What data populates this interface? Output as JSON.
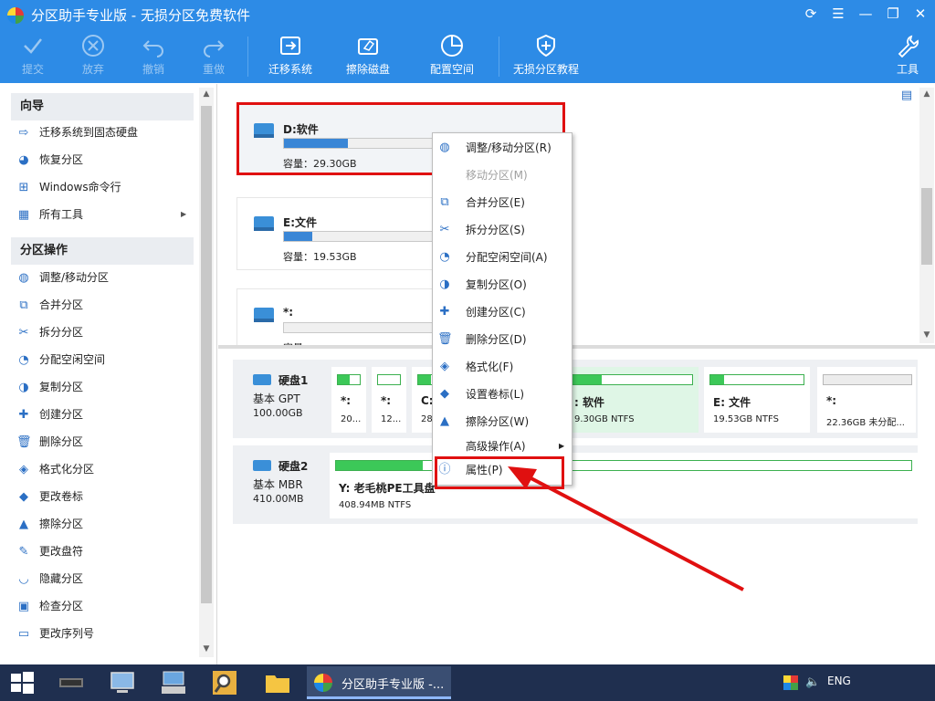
{
  "window": {
    "title": "分区助手专业版 - 无损分区免费软件"
  },
  "toolbar": {
    "submit": "提交",
    "discard": "放弃",
    "undo": "撤销",
    "redo": "重做",
    "migrate": "迁移系统",
    "wipe_disk": "擦除磁盘",
    "allocate": "配置空间",
    "tutorial": "无损分区教程",
    "tools": "工具"
  },
  "sidebar": {
    "wizard_header": "向导",
    "wizard_items": [
      {
        "label": "迁移系统到固态硬盘",
        "icon": "migrate-ssd-icon"
      },
      {
        "label": "恢复分区",
        "icon": "recover-icon"
      },
      {
        "label": "Windows命令行",
        "icon": "windows-icon"
      },
      {
        "label": "所有工具",
        "icon": "tools-grid-icon"
      }
    ],
    "ops_header": "分区操作",
    "ops_items": [
      {
        "label": "调整/移动分区",
        "icon": "resize-icon"
      },
      {
        "label": "合并分区",
        "icon": "merge-icon"
      },
      {
        "label": "拆分分区",
        "icon": "split-icon"
      },
      {
        "label": "分配空闲空间",
        "icon": "allocate-icon"
      },
      {
        "label": "复制分区",
        "icon": "copy-icon"
      },
      {
        "label": "创建分区",
        "icon": "create-icon"
      },
      {
        "label": "删除分区",
        "icon": "delete-icon"
      },
      {
        "label": "格式化分区",
        "icon": "format-icon"
      },
      {
        "label": "更改卷标",
        "icon": "label-icon"
      },
      {
        "label": "擦除分区",
        "icon": "wipe-icon"
      },
      {
        "label": "更改盘符",
        "icon": "drive-letter-icon"
      },
      {
        "label": "隐藏分区",
        "icon": "hide-icon"
      },
      {
        "label": "检查分区",
        "icon": "check-icon"
      },
      {
        "label": "更改序列号",
        "icon": "serial-icon"
      }
    ]
  },
  "partition_cards": [
    {
      "name": "D:软件",
      "capacity": "容量：29.30GB",
      "used": 0.25
    },
    {
      "name": "E:文件",
      "capacity": "容量：19.53GB",
      "used": 0.11
    },
    {
      "name": "*:",
      "capacity": "容量",
      "used": 0
    }
  ],
  "disks": [
    {
      "name": "硬盘1",
      "type": "基本 GPT",
      "size": "100.00GB",
      "partitions": [
        {
          "name": "*:",
          "detail": "20...",
          "used": 0.55
        },
        {
          "name": "*:",
          "detail": "12...",
          "used": 0.0
        },
        {
          "name": "C:",
          "detail": "28",
          "used": 0.5
        },
        {
          "name": ": 软件",
          "detail": "9.30GB NTFS",
          "used": 0.25
        },
        {
          "name": "E: 文件",
          "detail": "19.53GB NTFS",
          "used": 0.15
        },
        {
          "name": "*:",
          "detail": "22.36GB 未分配...",
          "used": 0
        }
      ]
    },
    {
      "name": "硬盘2",
      "type": "基本 MBR",
      "size": "410.00MB",
      "partitions": [
        {
          "name": "Y: 老毛桃PE工具盘",
          "detail": "408.94MB NTFS",
          "used": 0.15
        }
      ]
    }
  ],
  "context_menu": {
    "items": [
      {
        "label": "调整/移动分区(R)",
        "icon": "resize-icon",
        "disabled": false
      },
      {
        "label": "移动分区(M)",
        "icon": "",
        "disabled": true
      },
      {
        "label": "合并分区(E)",
        "icon": "merge-icon",
        "disabled": false
      },
      {
        "label": "拆分分区(S)",
        "icon": "split-icon",
        "disabled": false
      },
      {
        "label": "分配空闲空间(A)",
        "icon": "allocate-icon",
        "disabled": false
      },
      {
        "label": "复制分区(O)",
        "icon": "copy-icon",
        "disabled": false
      },
      {
        "label": "创建分区(C)",
        "icon": "create-icon",
        "disabled": false
      },
      {
        "label": "删除分区(D)",
        "icon": "delete-icon",
        "disabled": false
      },
      {
        "label": "格式化(F)",
        "icon": "format-icon",
        "disabled": false
      },
      {
        "label": "设置卷标(L)",
        "icon": "label-icon",
        "disabled": false
      },
      {
        "label": "擦除分区(W)",
        "icon": "wipe-icon",
        "disabled": false
      },
      {
        "label": "高级操作(A)",
        "icon": "",
        "disabled": false
      },
      {
        "label": "属性(P)",
        "icon": "info-icon",
        "disabled": false
      }
    ]
  },
  "taskbar": {
    "active_app": "分区助手专业版 -...",
    "language": "ENG"
  },
  "colors": {
    "header": "#2d8be6",
    "highlight": "#e01010",
    "bar_blue": "#3a86d6",
    "bar_green": "#3cc858",
    "taskbar": "#1f2f4f"
  }
}
